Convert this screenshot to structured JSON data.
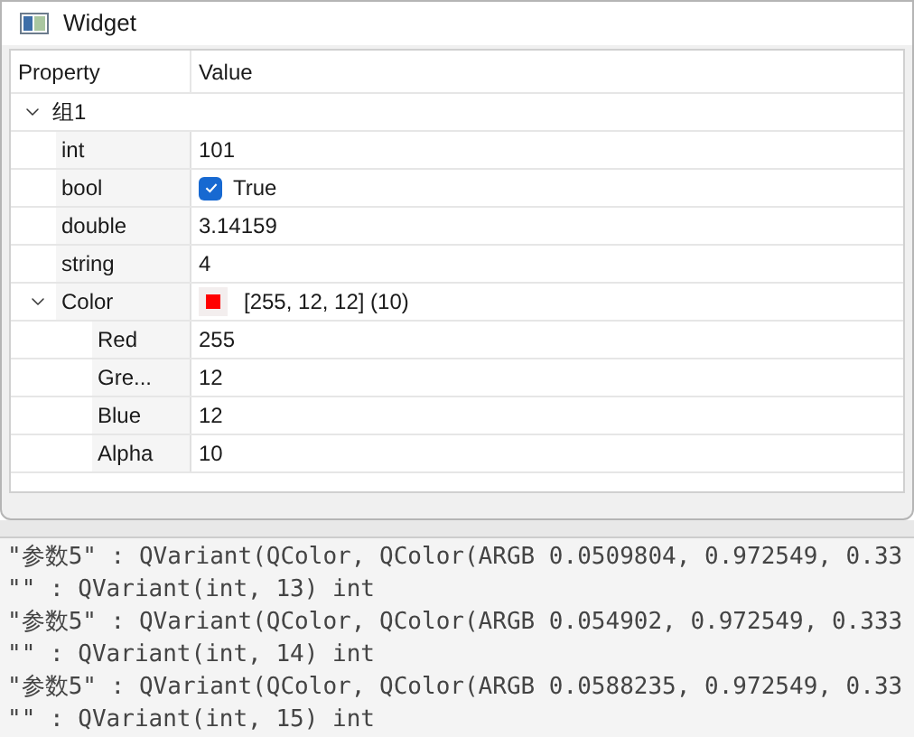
{
  "window": {
    "title": "Widget"
  },
  "tree": {
    "columns": [
      "Property",
      "Value"
    ],
    "items": [
      {
        "label": "组1",
        "kind": "group",
        "expanded": true,
        "children": [
          {
            "label": "int",
            "kind": "text",
            "value": "101"
          },
          {
            "label": "bool",
            "kind": "checkbox",
            "checked": true,
            "value": "True"
          },
          {
            "label": "double",
            "kind": "text",
            "value": "3.14159"
          },
          {
            "label": "string",
            "kind": "text",
            "value": "4"
          },
          {
            "label": "Color",
            "kind": "color",
            "color": "#ff0000",
            "value": "[255, 12, 12] (10)",
            "expanded": true,
            "children": [
              {
                "label": "Red",
                "kind": "text",
                "value": "255"
              },
              {
                "label": "Gre...",
                "kind": "text",
                "value": "12"
              },
              {
                "label": "Blue",
                "kind": "text",
                "value": "12"
              },
              {
                "label": "Alpha",
                "kind": "text",
                "value": "10"
              }
            ]
          }
        ]
      }
    ]
  },
  "console": {
    "lines": [
      "\"参数5\" : QVariant(QColor, QColor(ARGB 0.0509804, 0.972549, 0.33",
      "\"\" : QVariant(int, 13) int",
      "\"参数5\" : QVariant(QColor, QColor(ARGB 0.054902, 0.972549, 0.333",
      "\"\" : QVariant(int, 14) int",
      "\"参数5\" : QVariant(QColor, QColor(ARGB 0.0588235, 0.972549, 0.33",
      "\"\" : QVariant(int, 15) int"
    ]
  }
}
